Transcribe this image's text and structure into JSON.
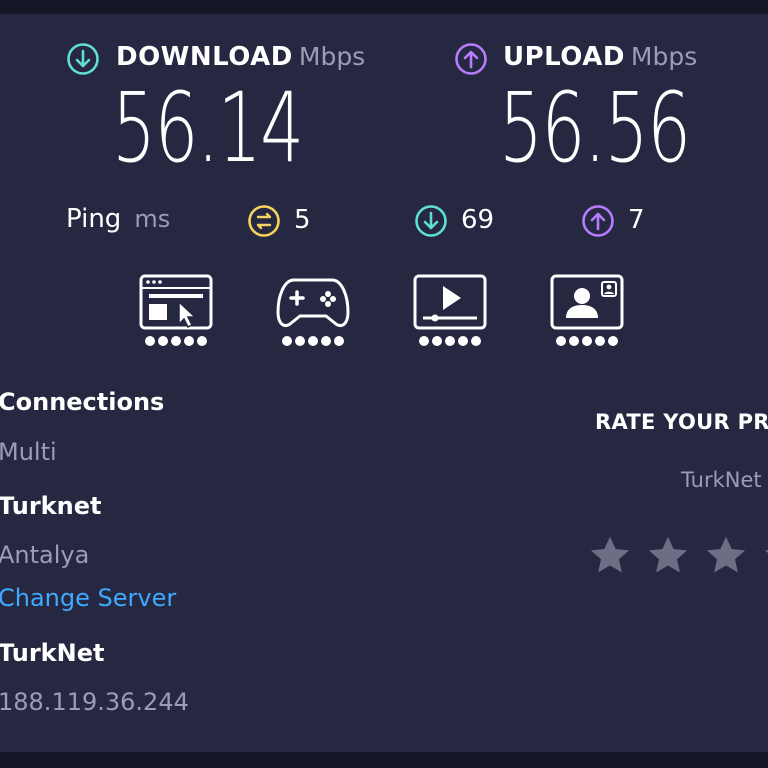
{
  "download": {
    "label": "DOWNLOAD",
    "unit": "Mbps",
    "value": "56.14",
    "icon": "arrow-down-circle-icon",
    "color": "#5ee0d0"
  },
  "upload": {
    "label": "UPLOAD",
    "unit": "Mbps",
    "value": "56.56",
    "icon": "arrow-up-circle-icon",
    "color": "#b67dff"
  },
  "ping": {
    "label": "Ping",
    "unit": "ms",
    "idle": {
      "value": "5",
      "icon": "idle-ping-icon",
      "color": "#f4d35e"
    },
    "download": {
      "value": "69",
      "icon": "arrow-down-circle-icon",
      "color": "#5ee0d0"
    },
    "upload": {
      "value": "7",
      "icon": "arrow-up-circle-icon",
      "color": "#b67dff"
    }
  },
  "usage_ratings": [
    {
      "name": "web-browsing-icon",
      "dots": 5
    },
    {
      "name": "gaming-controller-icon",
      "dots": 5
    },
    {
      "name": "video-streaming-icon",
      "dots": 5
    },
    {
      "name": "video-chat-icon",
      "dots": 5
    }
  ],
  "connections": {
    "title": "Connections",
    "mode": "Multi",
    "server_name": "Turknet",
    "server_location": "Antalya",
    "change_server": "Change Server",
    "isp_name": "TurkNet",
    "ip": "188.119.36.244"
  },
  "rate": {
    "title": "RATE YOUR PR",
    "isp": "TurkNet",
    "stars_visible": 4,
    "star_color": "#6d6e85"
  },
  "colors": {
    "background": "#262740",
    "accent_link": "#3fa9ff"
  }
}
